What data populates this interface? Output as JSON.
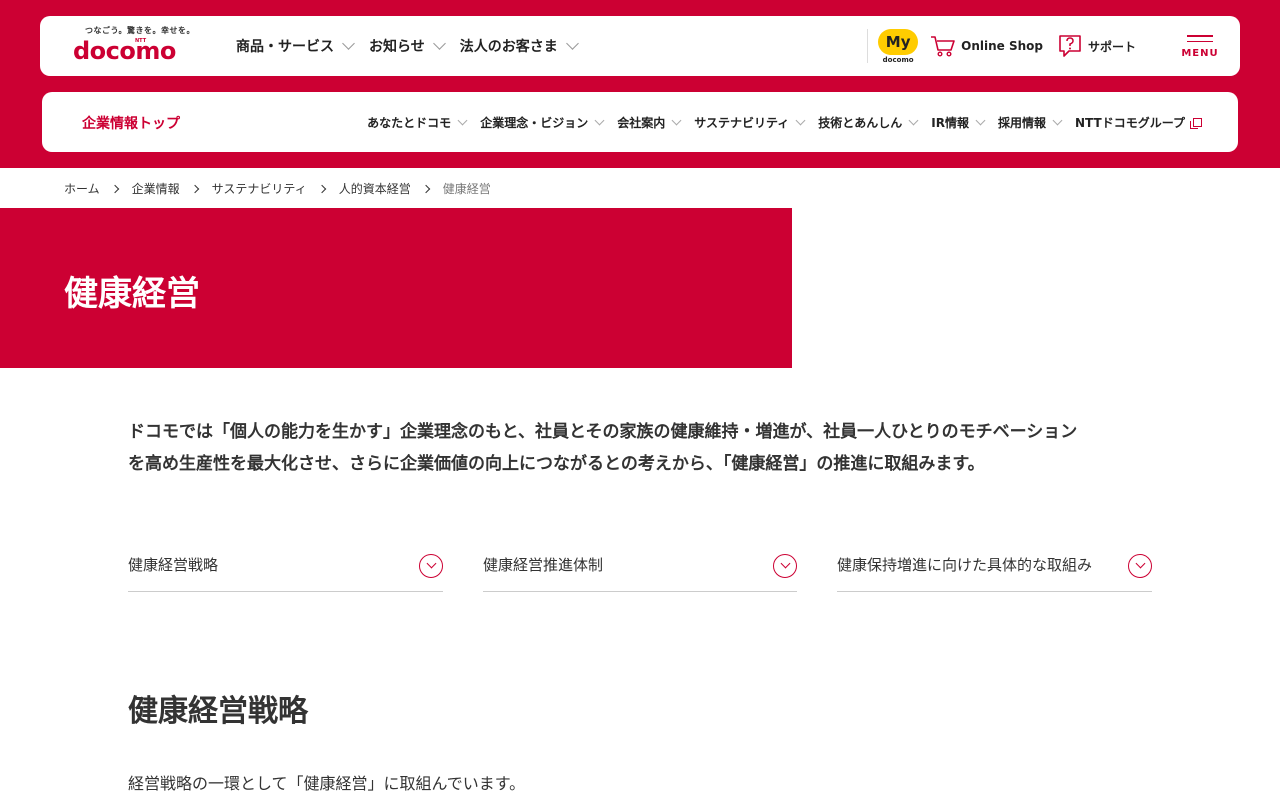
{
  "header": {
    "logo": {
      "tagline": "つなごう。驚きを。幸せを。",
      "ntt": "NTT",
      "wordmark": "docomo"
    },
    "nav": [
      {
        "label": "商品・サービス"
      },
      {
        "label": "お知らせ"
      },
      {
        "label": "法人のお客さま"
      }
    ],
    "my_docomo": {
      "badge": "My",
      "sub": "docomo"
    },
    "online_shop": "Online Shop",
    "support": "サポート",
    "menu": "MENU"
  },
  "subnav": {
    "title": "企業情報トップ",
    "items": [
      {
        "label": "あなたとドコモ"
      },
      {
        "label": "企業理念・ビジョン"
      },
      {
        "label": "会社案内"
      },
      {
        "label": "サステナビリティ"
      },
      {
        "label": "技術とあんしん"
      },
      {
        "label": "IR情報"
      },
      {
        "label": "採用情報"
      },
      {
        "label": "NTTドコモグループ"
      }
    ]
  },
  "breadcrumb": [
    "ホーム",
    "企業情報",
    "サステナビリティ",
    "人的資本経営",
    "健康経営"
  ],
  "hero": {
    "title": "健康経営"
  },
  "intro": {
    "line1": "ドコモでは「個人の能力を生かす」企業理念のもと、社員とその家族の健康維持・増進が、社員一人ひとりのモチベーション",
    "line2": "を高め生産性を最大化させ、さらに企業価値の向上につながるとの考えから、「健康経営」の推進に取組みます。"
  },
  "anchors": [
    {
      "label": "健康経営戦略"
    },
    {
      "label": "健康経営推進体制"
    },
    {
      "label": "健康保持増進に向けた具体的な取組み"
    }
  ],
  "section": {
    "title": "健康経営戦略",
    "body": "経営戦略の一環として「健康経営」に取組んでいます。"
  },
  "colors": {
    "brand": "#cc0033",
    "my_badge": "#ffcc00"
  },
  "icons": [
    "chevron-down-icon",
    "cart-icon",
    "question-icon",
    "hamburger-icon",
    "external-link-icon",
    "chevron-right-icon",
    "circle-chevron-down-icon"
  ]
}
